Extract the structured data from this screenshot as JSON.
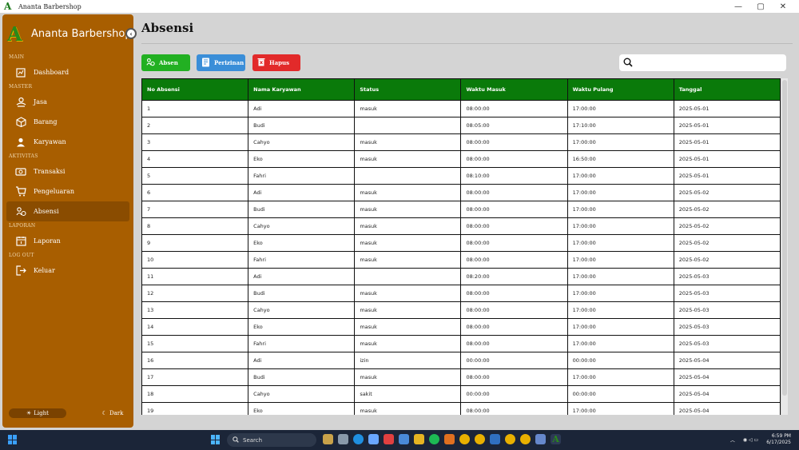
{
  "window": {
    "title": "Ananta Barbershop",
    "controls": [
      "—",
      "▢",
      "✕"
    ]
  },
  "sidebar": {
    "brand": "Ananta Barbershop",
    "brand_logo": "A",
    "sections": {
      "main": "MAIN",
      "master": "MASTER",
      "aktivitas": "AKTIVITAS",
      "laporan": "LAPORAN",
      "logout": "LOG OUT"
    },
    "items": {
      "dashboard": "Dashboard",
      "jasa": "Jasa",
      "barang": "Barang",
      "karyawan": "Karyawan",
      "transaksi": "Transaksi",
      "pengeluaran": "Pengeluaran",
      "absensi": "Absensi",
      "laporan": "Laporan",
      "keluar": "Keluar"
    },
    "active": "absensi",
    "theme": {
      "light": "Light",
      "dark": "Dark"
    },
    "accent": "#a85e00"
  },
  "main": {
    "title": "Absensi",
    "buttons": {
      "absen": "Absen",
      "perizinan": "Perizinan",
      "hapus": "Hapus"
    },
    "search_value": ""
  },
  "table": {
    "columns": [
      "No Absensi",
      "Nama Karyawan",
      "Status",
      "Waktu Masuk",
      "Waktu Pulang",
      "Tanggal"
    ],
    "rows": [
      [
        "1",
        "Adi",
        "masuk",
        "08:00:00",
        "17:00:00",
        "2025-05-01"
      ],
      [
        "2",
        "Budi",
        "",
        "08:05:00",
        "17:10:00",
        "2025-05-01"
      ],
      [
        "3",
        "Cahyo",
        "masuk",
        "08:00:00",
        "17:00:00",
        "2025-05-01"
      ],
      [
        "4",
        "Eko",
        "masuk",
        "08:00:00",
        "16:50:00",
        "2025-05-01"
      ],
      [
        "5",
        "Fahri",
        "",
        "08:10:00",
        "17:00:00",
        "2025-05-01"
      ],
      [
        "6",
        "Adi",
        "masuk",
        "08:00:00",
        "17:00:00",
        "2025-05-02"
      ],
      [
        "7",
        "Budi",
        "masuk",
        "08:00:00",
        "17:00:00",
        "2025-05-02"
      ],
      [
        "8",
        "Cahyo",
        "masuk",
        "08:00:00",
        "17:00:00",
        "2025-05-02"
      ],
      [
        "9",
        "Eko",
        "masuk",
        "08:00:00",
        "17:00:00",
        "2025-05-02"
      ],
      [
        "10",
        "Fahri",
        "masuk",
        "08:00:00",
        "17:00:00",
        "2025-05-02"
      ],
      [
        "11",
        "Adi",
        "",
        "08:20:00",
        "17:00:00",
        "2025-05-03"
      ],
      [
        "12",
        "Budi",
        "masuk",
        "08:00:00",
        "17:00:00",
        "2025-05-03"
      ],
      [
        "13",
        "Cahyo",
        "masuk",
        "08:00:00",
        "17:00:00",
        "2025-05-03"
      ],
      [
        "14",
        "Eko",
        "masuk",
        "08:00:00",
        "17:00:00",
        "2025-05-03"
      ],
      [
        "15",
        "Fahri",
        "masuk",
        "08:00:00",
        "17:00:00",
        "2025-05-03"
      ],
      [
        "16",
        "Adi",
        "izin",
        "00:00:00",
        "00:00:00",
        "2025-05-04"
      ],
      [
        "17",
        "Budi",
        "masuk",
        "08:00:00",
        "17:00:00",
        "2025-05-04"
      ],
      [
        "18",
        "Cahyo",
        "sakit",
        "00:00:00",
        "00:00:00",
        "2025-05-04"
      ],
      [
        "19",
        "Eko",
        "masuk",
        "08:00:00",
        "17:00:00",
        "2025-05-04"
      ]
    ]
  },
  "taskbar": {
    "search_label": "Search",
    "time": "6:59 PM",
    "date": "6/17/2025"
  }
}
